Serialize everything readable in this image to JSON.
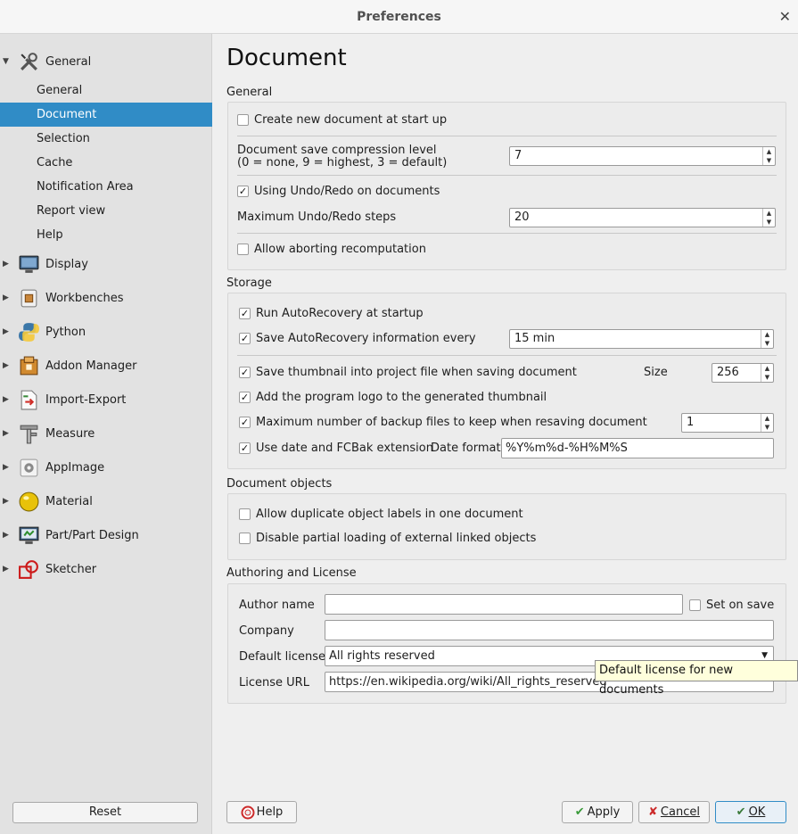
{
  "window": {
    "title": "Preferences",
    "close_icon": "close-icon"
  },
  "sidebar": {
    "groups": [
      {
        "label": "General",
        "icon": "tools-icon",
        "expanded": true
      },
      {
        "label": "Display",
        "icon": "monitor-icon"
      },
      {
        "label": "Workbenches",
        "icon": "workbench-icon"
      },
      {
        "label": "Python",
        "icon": "python-icon"
      },
      {
        "label": "Addon Manager",
        "icon": "addon-icon"
      },
      {
        "label": "Import-Export",
        "icon": "import-export-icon"
      },
      {
        "label": "Measure",
        "icon": "measure-icon"
      },
      {
        "label": "AppImage",
        "icon": "appimage-icon"
      },
      {
        "label": "Material",
        "icon": "material-icon"
      },
      {
        "label": "Part/Part Design",
        "icon": "part-icon"
      },
      {
        "label": "Sketcher",
        "icon": "sketcher-icon"
      }
    ],
    "general_items": [
      "General",
      "Document",
      "Selection",
      "Cache",
      "Notification Area",
      "Report view",
      "Help"
    ],
    "active_item": "Document",
    "reset_label": "Reset"
  },
  "page": {
    "title": "Document",
    "general": {
      "title": "General",
      "create_new_doc": "Create new document at start up",
      "compression_label_1": "Document save compression level",
      "compression_label_2": "(0 = none, 9 = highest, 3 = default)",
      "compression_value": "7",
      "undo_redo": "Using Undo/Redo on documents",
      "max_undo_label": "Maximum Undo/Redo steps",
      "max_undo_value": "20",
      "allow_abort": "Allow aborting recomputation"
    },
    "storage": {
      "title": "Storage",
      "run_autorecovery": "Run AutoRecovery at startup",
      "save_autorecovery": "Save AutoRecovery information every",
      "autorecovery_value": "15 min",
      "save_thumbnail": "Save thumbnail into project file when saving document",
      "size_label": "Size",
      "size_value": "256",
      "add_logo": "Add the program logo to the generated thumbnail",
      "max_backup": "Maximum number of backup files to keep when resaving document",
      "max_backup_value": "1",
      "use_date": "Use date and FCBak extension",
      "date_format_label": "Date format",
      "date_format_value": "%Y%m%d-%H%M%S"
    },
    "doc_objects": {
      "title": "Document objects",
      "allow_duplicate": "Allow duplicate object labels in one document",
      "disable_partial": "Disable partial loading of external linked objects"
    },
    "authoring": {
      "title": "Authoring and License",
      "author_label": "Author name",
      "author_value": "",
      "set_on_save": "Set on save",
      "company_label": "Company",
      "company_value": "",
      "license_label": "Default license",
      "license_value": "All rights reserved",
      "url_label": "License URL",
      "url_value": "https://en.wikipedia.org/wiki/All_rights_reserved",
      "tooltip": "Default license for new documents"
    }
  },
  "buttons": {
    "help": "Help",
    "apply": "Apply",
    "cancel": "Cancel",
    "ok": "OK"
  }
}
